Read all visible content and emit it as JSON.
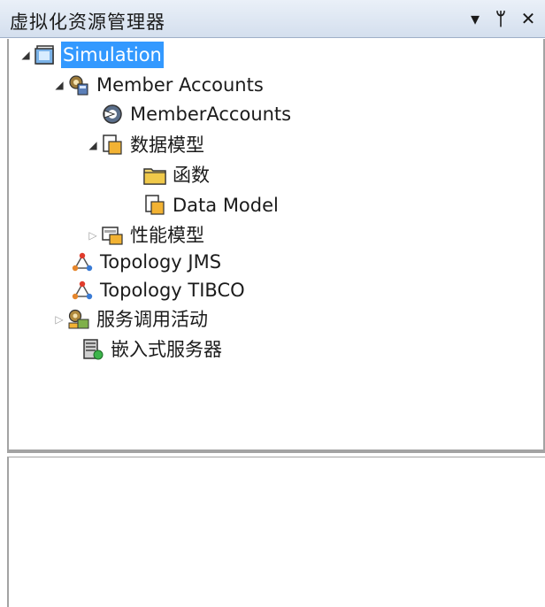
{
  "panel": {
    "title": "虚拟化资源管理器",
    "buttons": [
      {
        "name": "dropdown-icon",
        "glyph": "▼"
      },
      {
        "name": "pin-icon",
        "glyph": "ꟸ"
      },
      {
        "name": "close-icon",
        "glyph": "✕"
      }
    ]
  },
  "tree": {
    "simulation": {
      "label": "Simulation",
      "icon": "project-folder-icon",
      "expanded": true,
      "selected": true
    },
    "member_accounts": {
      "label": "Member Accounts",
      "icon": "service-gear-icon",
      "expanded": true
    },
    "member_accounts_item": {
      "label": "MemberAccounts",
      "icon": "operation-circle-icon"
    },
    "data_model_group": {
      "label": "数据模型",
      "icon": "data-model-icon",
      "expanded": true
    },
    "functions": {
      "label": "函数",
      "icon": "folder-icon"
    },
    "data_model": {
      "label": "Data Model",
      "icon": "data-model-icon"
    },
    "performance_model": {
      "label": "性能模型",
      "icon": "performance-model-icon",
      "expanded": false
    },
    "topology_jms": {
      "label": "Topology JMS",
      "icon": "topology-icon"
    },
    "topology_tibco": {
      "label": "Topology TIBCO",
      "icon": "topology-icon"
    },
    "service_activities": {
      "label": "服务调用活动",
      "icon": "service-activity-icon",
      "expanded": false
    },
    "embedded_servers": {
      "label": "嵌入式服务器",
      "icon": "server-icon"
    }
  },
  "colors": {
    "selection": "#3399ff",
    "title_bar": "#d4dfee",
    "border": "#a3a3a3"
  }
}
